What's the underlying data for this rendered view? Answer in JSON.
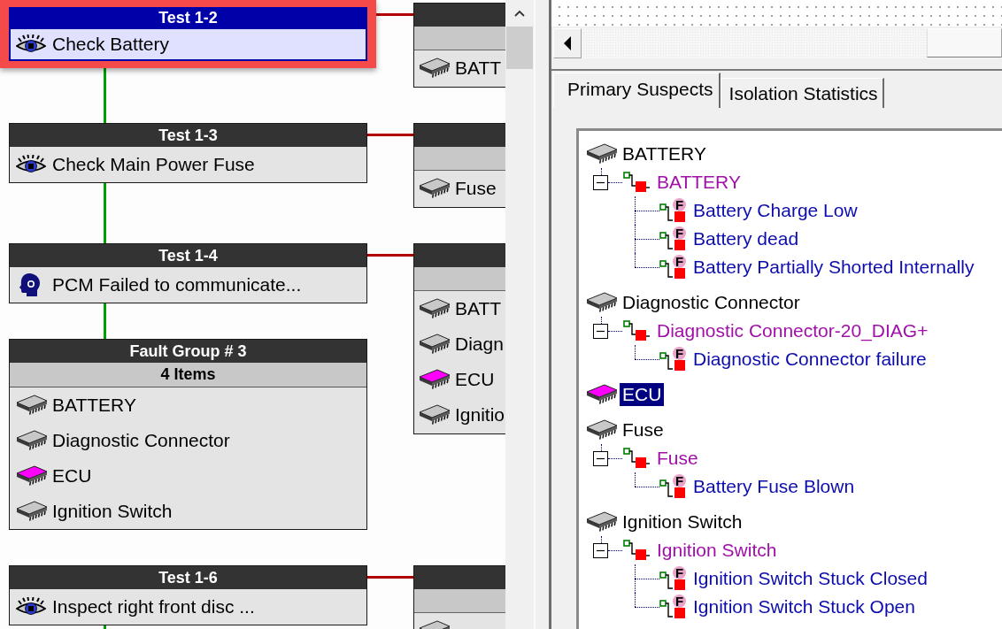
{
  "flowchart": {
    "nodes": [
      {
        "kind": "test",
        "title": "Test 1-2",
        "selected": true,
        "step": {
          "kind": "inspect",
          "text": "Check Battery"
        },
        "outcome": {
          "items": [
            {
              "text": "BATT",
              "color": "#c8c8c8"
            }
          ]
        }
      },
      {
        "kind": "test",
        "title": "Test 1-3",
        "selected": false,
        "step": {
          "kind": "inspect",
          "text": "Check Main Power Fuse"
        },
        "outcome": {
          "items": [
            {
              "text": "Fuse",
              "color": "#c8c8c8"
            }
          ]
        }
      },
      {
        "kind": "test",
        "title": "Test 1-4",
        "selected": false,
        "step": {
          "kind": "message",
          "text": "PCM Failed to communicate..."
        },
        "outcome": {
          "items": [
            {
              "text": "BATT",
              "color": "#c8c8c8"
            },
            {
              "text": "Diagn",
              "color": "#c8c8c8"
            },
            {
              "text": "ECU",
              "color": "#ff00ff"
            },
            {
              "text": "Ignitio",
              "color": "#c8c8c8"
            }
          ]
        }
      },
      {
        "kind": "fault_group",
        "title": "Fault Group # 3",
        "selected": false,
        "count": "4 Items",
        "items": [
          {
            "text": "BATTERY",
            "color": "#c8c8c8"
          },
          {
            "text": "Diagnostic Connector",
            "color": "#c8c8c8"
          },
          {
            "text": "ECU",
            "color": "#ff00ff"
          },
          {
            "text": "Ignition Switch",
            "color": "#c8c8c8"
          }
        ]
      },
      {
        "kind": "test",
        "title": "Test 1-6",
        "selected": false,
        "step": {
          "kind": "inspect",
          "text": "Inspect right front disc ..."
        },
        "outcome": {
          "items": [
            {
              "color": "#c8c8c8"
            }
          ]
        }
      }
    ]
  },
  "tabs": [
    {
      "label": "Primary Suspects",
      "selected": true
    },
    {
      "label": "Isolation Statistics",
      "selected": false
    }
  ],
  "suspects": [
    {
      "text": "BATTERY",
      "color": "#c8c8c8",
      "selected": false,
      "children": [
        {
          "text": "BATTERY",
          "expanded": true,
          "children": [
            {
              "text": "Battery Charge Low",
              "badge": "F"
            },
            {
              "text": "Battery dead",
              "badge": "F"
            },
            {
              "text": "Battery Partially Shorted Internally",
              "badge": "F"
            }
          ]
        }
      ]
    },
    {
      "text": "Diagnostic Connector",
      "color": "#c8c8c8",
      "selected": false,
      "children": [
        {
          "text": "Diagnostic Connector-20_DIAG+",
          "expanded": true,
          "children": [
            {
              "text": "Diagnostic Connector failure",
              "badge": "F"
            }
          ]
        }
      ]
    },
    {
      "text": "ECU",
      "color": "#ff00ff",
      "selected": true
    },
    {
      "text": "Fuse",
      "color": "#c8c8c8",
      "selected": false,
      "children": [
        {
          "text": "Fuse",
          "expanded": true,
          "children": [
            {
              "text": "Battery Fuse Blown",
              "badge": "F"
            }
          ]
        }
      ]
    },
    {
      "text": "Ignition Switch",
      "color": "#c8c8c8",
      "selected": false,
      "children": [
        {
          "text": "Ignition Switch",
          "expanded": true,
          "children": [
            {
              "text": "Ignition Switch Stuck Closed",
              "badge": "F"
            },
            {
              "text": "Ignition Switch Stuck Open",
              "badge": "F"
            }
          ]
        }
      ]
    }
  ]
}
